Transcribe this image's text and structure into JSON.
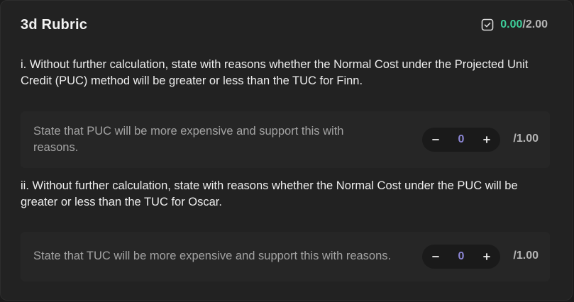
{
  "rubric": {
    "title": "3d Rubric",
    "score": {
      "earned": "0.00",
      "separator": "/",
      "total": "2.00",
      "icon": "check-square-icon",
      "earned_color": "#3ecf9b"
    },
    "items": [
      {
        "question": "i. Without further calculation, state with reasons whether the Normal Cost under the Projected Unit Credit (PUC) method will be greater or less than the TUC for Finn.",
        "criterion": "State that PUC will be more expensive and support this with reasons.",
        "value": "0",
        "max": "/1.00"
      },
      {
        "question": "ii. Without further calculation, state with reasons whether the Normal Cost under the PUC will be greater or less than the TUC for Oscar.",
        "criterion": "State that TUC will be more expensive and support this with reasons.",
        "value": "0",
        "max": "/1.00"
      }
    ],
    "stepper": {
      "minus_icon": "minus-icon",
      "plus_icon": "plus-icon"
    },
    "colors": {
      "background": "#222222",
      "card": "#262626",
      "stepper_value": "#8d87d6"
    }
  }
}
